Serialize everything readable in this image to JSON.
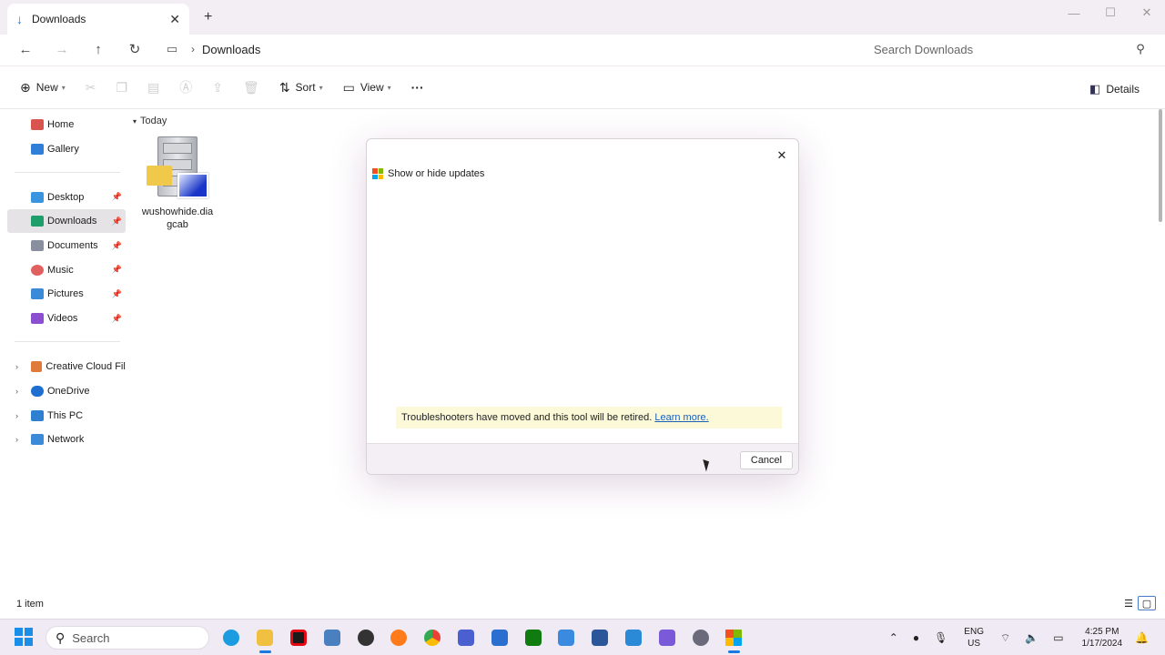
{
  "window": {
    "tab_title": "Downloads",
    "new_tab": "+",
    "close_tab": "✕"
  },
  "address": {
    "crumb": "Downloads",
    "search_placeholder": "Search Downloads"
  },
  "toolbar": {
    "new_label": "New",
    "sort_label": "Sort",
    "view_label": "View",
    "more_label": "···",
    "details_label": "Details"
  },
  "sidebar": {
    "quick": [
      {
        "label": "Home",
        "color": "#d9534f"
      },
      {
        "label": "Gallery",
        "color": "#2f7fd8"
      }
    ],
    "pinned": [
      {
        "label": "Desktop",
        "color": "#3a95e0"
      },
      {
        "label": "Downloads",
        "color": "#1f9e6b"
      },
      {
        "label": "Documents",
        "color": "#8a8fa0"
      },
      {
        "label": "Music",
        "color": "#e06060"
      },
      {
        "label": "Pictures",
        "color": "#3b8ad8"
      },
      {
        "label": "Videos",
        "color": "#8b4ed0"
      }
    ],
    "locations": [
      {
        "label": "Creative Cloud Files",
        "color": "#e07a3a"
      },
      {
        "label": "OneDrive",
        "color": "#1f6fd0"
      },
      {
        "label": "This PC",
        "color": "#2f80d0"
      },
      {
        "label": "Network",
        "color": "#3a8ad8"
      }
    ]
  },
  "content": {
    "group": "Today",
    "file_name": "wushowhide.diagcab"
  },
  "status": {
    "item_count": "1 item"
  },
  "dialog": {
    "title": "Show or hide updates",
    "notice_text": "Troubleshooters have moved and this tool will be retired.",
    "notice_link": "Learn more.",
    "cancel_label": "Cancel"
  },
  "taskbar": {
    "search_label": "Search",
    "apps": [
      {
        "name": "edge-icon",
        "color": "#1b9be0"
      },
      {
        "name": "file-explorer-icon",
        "color": "#f0c040"
      },
      {
        "name": "netflix-icon",
        "color": "#e50914"
      },
      {
        "name": "folder-icon",
        "color": "#4a7fc0"
      },
      {
        "name": "media-icon",
        "color": "#333333"
      },
      {
        "name": "firefox-icon",
        "color": "#ff7a1a"
      },
      {
        "name": "chrome-icon",
        "color": "#34a853"
      },
      {
        "name": "calculator-icon",
        "color": "#4a5fd0"
      },
      {
        "name": "store-icon",
        "color": "#2a6fd0"
      },
      {
        "name": "xbox-icon",
        "color": "#107c10"
      },
      {
        "name": "notepad-icon",
        "color": "#3a8ae0"
      },
      {
        "name": "word-icon",
        "color": "#2b579a"
      },
      {
        "name": "paint-icon",
        "color": "#2a8ad8"
      },
      {
        "name": "snipping-tool-icon",
        "color": "#7a5ad8"
      },
      {
        "name": "settings-icon",
        "color": "#6a6a7a"
      },
      {
        "name": "windows-update-icon",
        "color": "#f25022"
      }
    ],
    "lang_line1": "ENG",
    "lang_line2": "US",
    "time": "4:25 PM",
    "date": "1/17/2024"
  }
}
